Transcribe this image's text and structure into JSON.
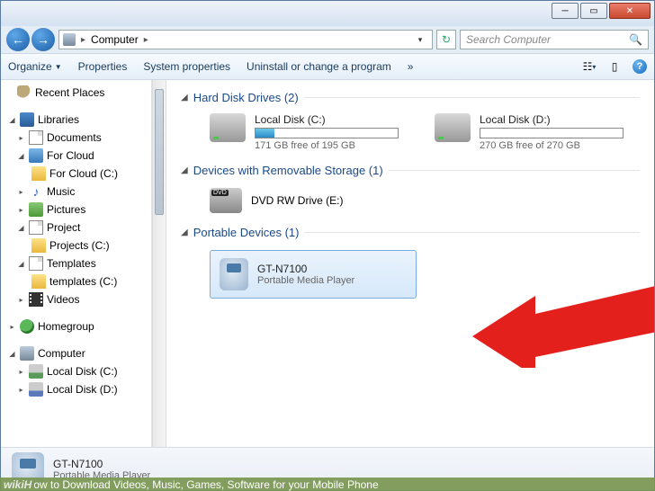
{
  "address": {
    "location": "Computer"
  },
  "search": {
    "placeholder": "Search Computer"
  },
  "toolbar": {
    "organize": "Organize",
    "properties": "Properties",
    "sysprops": "System properties",
    "uninstall": "Uninstall or change a program",
    "more": "»"
  },
  "sidebar": {
    "recent": "Recent Places",
    "libraries": "Libraries",
    "documents": "Documents",
    "forcloud": "For Cloud",
    "forcloud_c": "For Cloud (C:)",
    "music": "Music",
    "pictures": "Pictures",
    "project": "Project",
    "projects_c": "Projects (C:)",
    "templates": "Templates",
    "templates_c": "templates (C:)",
    "videos": "Videos",
    "homegroup": "Homegroup",
    "computer": "Computer",
    "local_c": "Local Disk (C:)",
    "local_d": "Local Disk (D:)"
  },
  "sections": {
    "hdd": {
      "title": "Hard Disk Drives (2)"
    },
    "removable": {
      "title": "Devices with Removable Storage (1)"
    },
    "portable": {
      "title": "Portable Devices (1)"
    }
  },
  "drives": {
    "c": {
      "name": "Local Disk (C:)",
      "free_text": "171 GB free of 195 GB",
      "fill_pct": 13
    },
    "d": {
      "name": "Local Disk (D:)",
      "free_text": "270 GB free of 270 GB",
      "fill_pct": 0
    },
    "dvd": {
      "name": "DVD RW Drive (E:)"
    }
  },
  "portable_device": {
    "name": "GT-N7100",
    "type": "Portable Media Player"
  },
  "details": {
    "name": "GT-N7100",
    "type": "Portable Media Player"
  },
  "caption": {
    "logo": "wikiH",
    "text": "ow to Download Videos, Music, Games, Software for your Mobile Phone"
  }
}
